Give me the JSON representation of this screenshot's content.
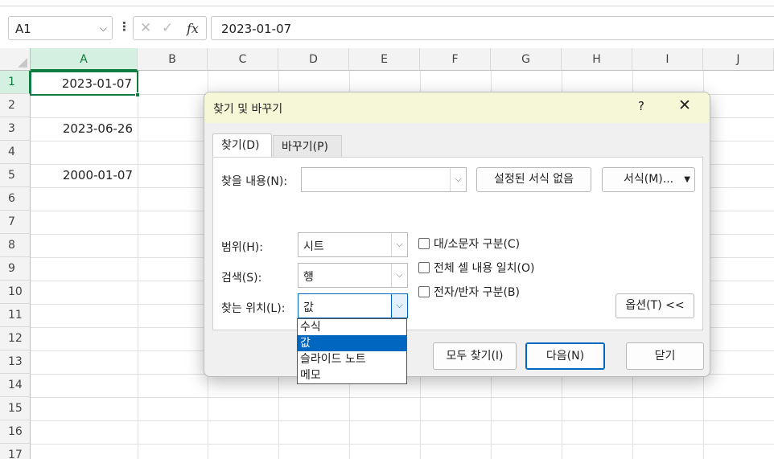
{
  "formula_bar": {
    "name_box": "A1",
    "fx_label": "fx",
    "cancel_glyph": "✕",
    "enter_glyph": "✓",
    "formula_value": "2023-01-07"
  },
  "columns": [
    "A",
    "B",
    "C",
    "D",
    "E",
    "F",
    "G",
    "H",
    "I",
    "J"
  ],
  "rows": [
    "1",
    "2",
    "3",
    "4",
    "5",
    "6",
    "7",
    "8",
    "9",
    "10",
    "11",
    "12",
    "13",
    "14",
    "15",
    "16",
    "17"
  ],
  "cells": {
    "A1": "2023-01-07",
    "A3": "2023-06-26",
    "A5": "2000-01-07"
  },
  "dialog": {
    "title": "찾기 및 바꾸기",
    "help": "?",
    "close": "✕",
    "tabs": [
      {
        "label": "찾기(D)",
        "active": true
      },
      {
        "label": "바꾸기(P)",
        "active": false
      }
    ],
    "find_label": "찾을 내용(N):",
    "find_value": "",
    "no_format_button": "설정된 서식 없음",
    "format_button": "서식(M)...",
    "within_label": "범위(H):",
    "within_value": "시트",
    "search_label": "검색(S):",
    "search_value": "행",
    "look_in_label": "찾는 위치(L):",
    "look_in_value": "값",
    "match_case": "대/소문자 구분(C)",
    "match_entire": "전체 셀 내용 일치(O)",
    "match_byte": "전자/반자 구분(B)",
    "options_button": "옵션(T) <<",
    "find_all_button": "모두 찾기(I)",
    "find_next_button": "다음(N)",
    "close_button": "닫기"
  },
  "look_in_options": [
    {
      "label": "수식",
      "selected": false
    },
    {
      "label": "값",
      "selected": true
    },
    {
      "label": "슬라이드 노트",
      "selected": false
    },
    {
      "label": "메모",
      "selected": false
    }
  ],
  "colors": {
    "accent_green": "#107c41",
    "dialog_title_bg": "#f5f7d6",
    "selection_blue": "#0067c0"
  }
}
